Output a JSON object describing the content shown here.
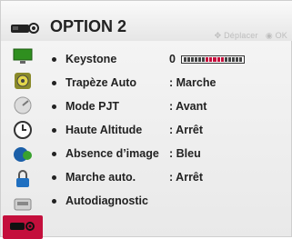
{
  "header": {
    "title": "OPTION 2",
    "hint_move": "Déplacer",
    "hint_ok": "OK",
    "icon": "option-icon"
  },
  "sidebar": {
    "items": [
      {
        "icon": "picture-icon"
      },
      {
        "icon": "audio-icon"
      },
      {
        "icon": "settings-disc-icon"
      },
      {
        "icon": "clock-icon"
      },
      {
        "icon": "option1-icon"
      },
      {
        "icon": "lock-icon"
      },
      {
        "icon": "input-icon"
      },
      {
        "icon": "option2-icon",
        "active": true
      }
    ]
  },
  "menu": {
    "items": [
      {
        "label": "Keystone",
        "value": "0"
      },
      {
        "label": "Trapèze Auto",
        "value": ": Marche"
      },
      {
        "label": "Mode PJT",
        "value": ": Avant"
      },
      {
        "label": "Haute Altitude",
        "value": ": Arrêt"
      },
      {
        "label": "Absence d’image",
        "value": ": Bleu"
      },
      {
        "label": "Marche auto.",
        "value": ": Arrêt"
      },
      {
        "label": "Autodiagnostic",
        "value": ""
      }
    ],
    "keystone_level": 0.5
  },
  "colors": {
    "accent": "#c40f3c",
    "text": "#222222",
    "hint": "#bdbdbd"
  }
}
